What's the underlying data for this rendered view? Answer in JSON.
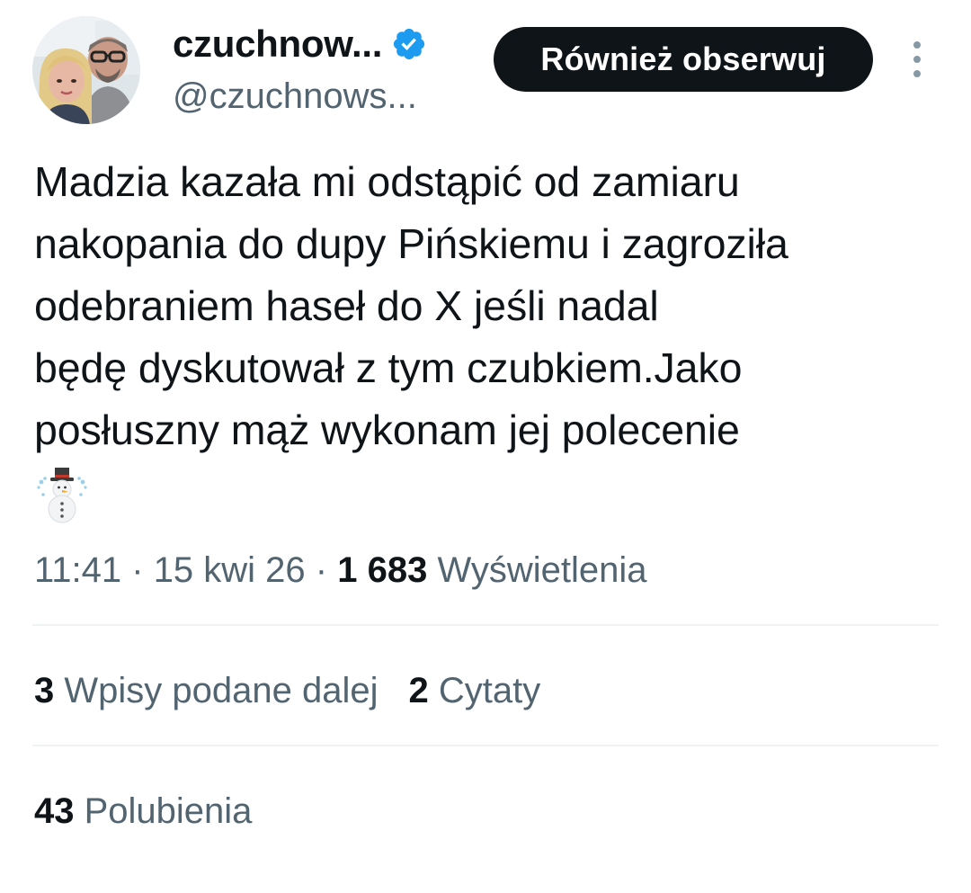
{
  "author": {
    "display_name": "czuchnow...",
    "handle": "@czuchnows...",
    "verified": true,
    "verified_color": "#1d9bf0",
    "avatar_icon": "profile-photo"
  },
  "follow_button": {
    "label": "Również obserwuj"
  },
  "more_icon": "more-vertical-icon",
  "tweet": {
    "text": "Madzia kazała mi odstąpić od zamiaru\nnakopania do dupy Pińskiemu i zagroziła\nodebraniem haseł do X jeśli nadal\nbędę dyskutował z tym czubkiem.Jako\nposłuszny mąż wykonam jej polecenie",
    "emoji": "snowman-icon"
  },
  "meta": {
    "time": "11:41",
    "sep1": " · ",
    "date": "15 kwi 26",
    "sep2": " · ",
    "views_count": "1 683",
    "views_label": " Wyświetlenia"
  },
  "stats": {
    "reposts_count": "3",
    "reposts_label": " Wpisy podane dalej",
    "quotes_count": "2",
    "quotes_label": " Cytaty",
    "likes_count": "43",
    "likes_label": " Polubienia"
  },
  "colors": {
    "text_primary": "#0f1419",
    "text_secondary": "#536471",
    "divider": "#eff3f4",
    "button_bg": "#0f1419"
  }
}
